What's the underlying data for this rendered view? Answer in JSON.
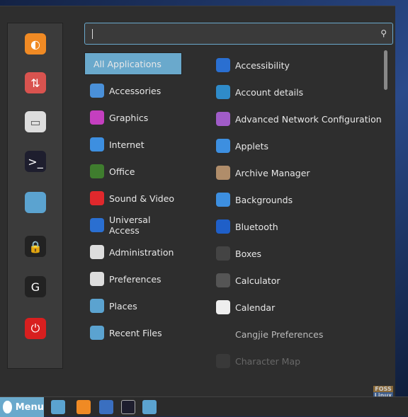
{
  "search": {
    "value": "",
    "icon": "search-icon"
  },
  "categories": [
    {
      "label": "All Applications",
      "selected": true
    },
    {
      "label": "Accessories",
      "icon": "scissors-icon",
      "color": "#4a90d9"
    },
    {
      "label": "Graphics",
      "icon": "palette-icon",
      "color": "#c43fbf"
    },
    {
      "label": "Internet",
      "icon": "cloud-icon",
      "color": "#3d8fe0"
    },
    {
      "label": "Office",
      "icon": "document-icon",
      "color": "#3f7d2e"
    },
    {
      "label": "Sound & Video",
      "icon": "play-icon",
      "color": "#e0282c"
    },
    {
      "label": "Universal Access",
      "icon": "accessibility-icon",
      "color": "#2a6fd1"
    },
    {
      "label": "Administration",
      "icon": "toggle-icon",
      "color": "#ddd"
    },
    {
      "label": "Preferences",
      "icon": "settings-icon",
      "color": "#ddd"
    },
    {
      "label": "Places",
      "icon": "folder-icon",
      "color": "#5ba3d0"
    },
    {
      "label": "Recent Files",
      "icon": "recent-folder-icon",
      "color": "#5ba3d0"
    }
  ],
  "apps": [
    {
      "label": "Accessibility",
      "icon": "accessibility-icon",
      "color": "#2a6fd1"
    },
    {
      "label": "Account details",
      "icon": "user-icon",
      "color": "#2f8bc9"
    },
    {
      "label": "Advanced Network Configuration",
      "icon": "network-icon",
      "color": "#a05cc8"
    },
    {
      "label": "Applets",
      "icon": "applets-icon",
      "color": "#3d8fe0"
    },
    {
      "label": "Archive Manager",
      "icon": "archive-icon",
      "color": "#b08d6a"
    },
    {
      "label": "Backgrounds",
      "icon": "image-icon",
      "color": "#3d8fe0"
    },
    {
      "label": "Bluetooth",
      "icon": "bluetooth-icon",
      "color": "#1f5fc8"
    },
    {
      "label": "Boxes",
      "icon": "boxes-icon",
      "color": "#444"
    },
    {
      "label": "Calculator",
      "icon": "calculator-icon",
      "color": "#555"
    },
    {
      "label": "Calendar",
      "icon": "calendar-icon",
      "color": "#eee"
    },
    {
      "label": "Cangjie Preferences",
      "icon": "",
      "color": ""
    },
    {
      "label": "Character Map",
      "icon": "character-map-icon",
      "color": "#555"
    }
  ],
  "sidebar": [
    {
      "name": "firefox",
      "color": "#f08a24",
      "glyph": "◐"
    },
    {
      "name": "package-manager",
      "color": "#d9534f",
      "glyph": "⇅"
    },
    {
      "name": "settings",
      "color": "#ddd",
      "glyph": "▭"
    },
    {
      "name": "terminal",
      "color": "#1e1e2e",
      "glyph": ">_"
    },
    {
      "name": "files",
      "color": "#5ba3d0",
      "glyph": ""
    },
    {
      "name": "lock",
      "color": "#222",
      "glyph": "🔒"
    },
    {
      "name": "logout",
      "color": "#222",
      "glyph": "G"
    },
    {
      "name": "shutdown",
      "color": "#d81f1f",
      "glyph": "⏻"
    }
  ],
  "taskbar": {
    "menu_label": "Menu",
    "items": [
      "show-desktop",
      "firefox",
      "mail",
      "terminal",
      "files"
    ]
  },
  "watermark": {
    "line1": "FOSS",
    "line2": "Linux"
  }
}
